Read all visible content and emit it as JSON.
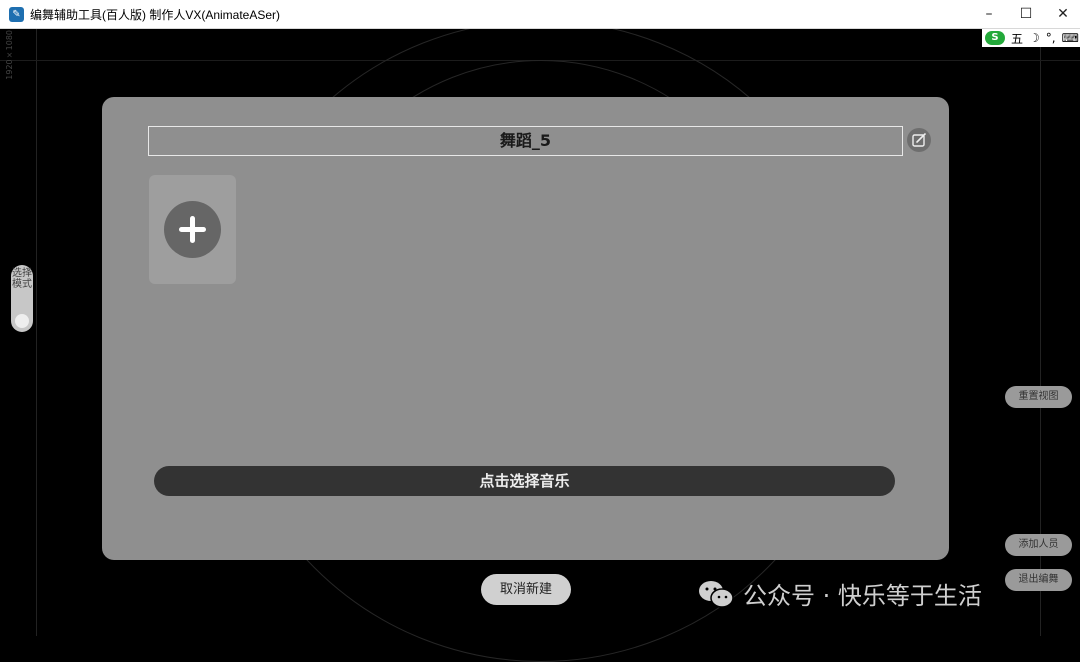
{
  "window": {
    "title": "编舞辅助工具(百人版)  制作人VX(AnimateASer)",
    "minimize": "–",
    "maximize": "☐",
    "close": "✕"
  },
  "ime": {
    "mode": "五",
    "moon": "☽",
    "punct": "°,",
    "keyboard": "⌨"
  },
  "stage": {
    "coord_label": "1920×1080"
  },
  "mode_toggle": {
    "label": "选择模式"
  },
  "side_buttons": {
    "reset_view": "重置视图",
    "add_member": "添加人员",
    "exit_edit": "退出编舞"
  },
  "dialog": {
    "dance_name": "舞蹈_5",
    "select_music": "点击选择音乐",
    "cancel": "取消新建"
  },
  "watermark": {
    "text": "公众号 · 快乐等于生活"
  }
}
